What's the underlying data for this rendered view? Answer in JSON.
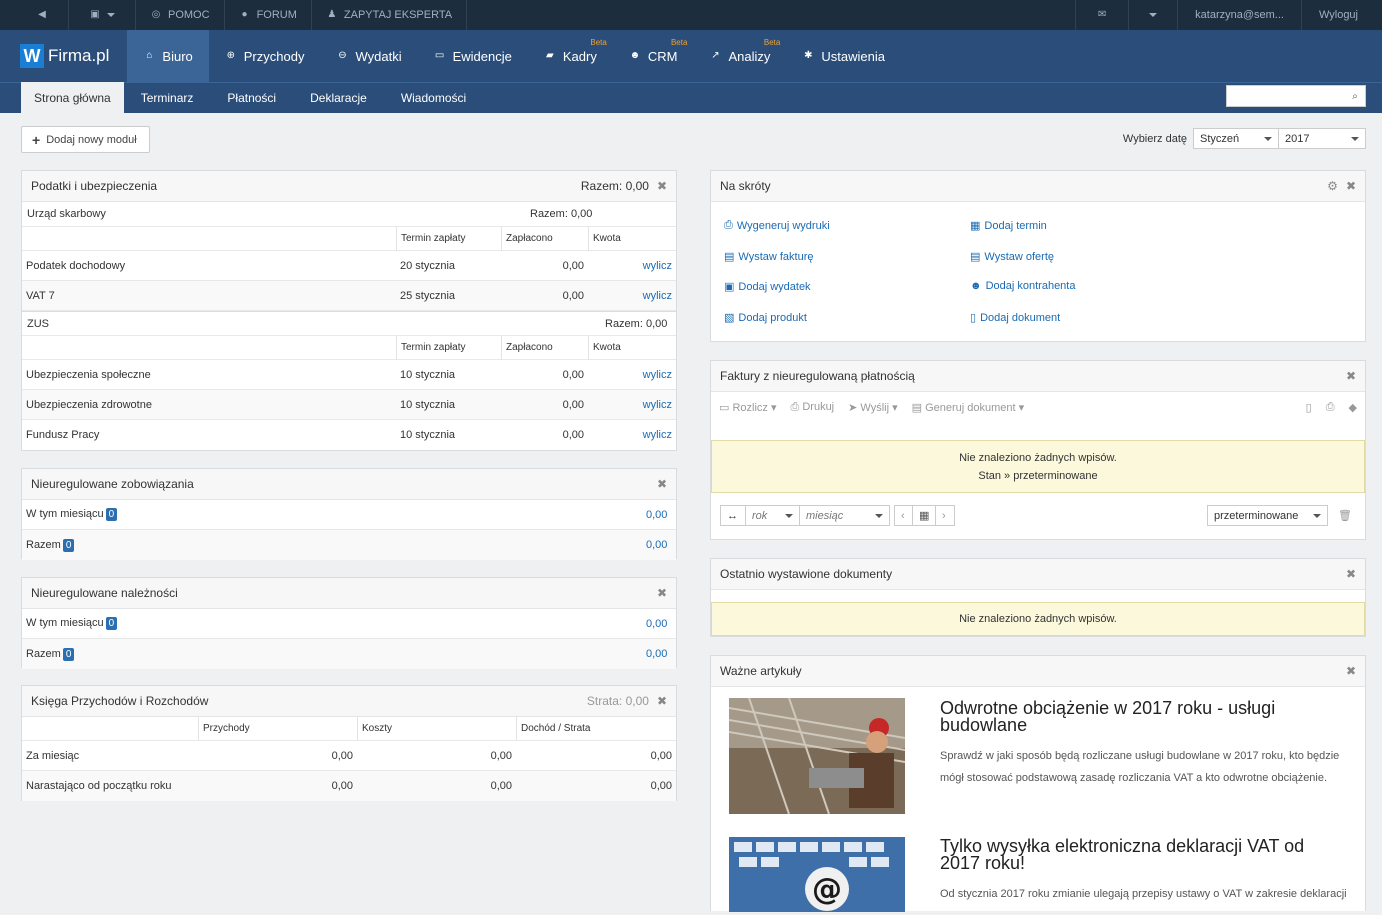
{
  "topbar": {
    "help": "POMOC",
    "forum": "FORUM",
    "expert": "ZAPYTAJ EKSPERTA",
    "user": "katarzyna@sem...",
    "logout": "Wyloguj"
  },
  "brand": {
    "name": "Firma.pl",
    "letter": "W"
  },
  "nav": [
    {
      "label": "Biuro"
    },
    {
      "label": "Przychody"
    },
    {
      "label": "Wydatki"
    },
    {
      "label": "Ewidencje"
    },
    {
      "label": "Kadry",
      "beta": "Beta"
    },
    {
      "label": "CRM",
      "beta": "Beta"
    },
    {
      "label": "Analizy",
      "beta": "Beta"
    },
    {
      "label": "Ustawienia"
    }
  ],
  "subnav": [
    "Strona główna",
    "Terminarz",
    "Płatności",
    "Deklaracje",
    "Wiadomości"
  ],
  "toolbar": {
    "add_module": "Dodaj nowy moduł",
    "date_label": "Wybierz datę",
    "month": "Styczeń",
    "year": "2017"
  },
  "taxes": {
    "title": "Podatki i ubezpieczenia",
    "total": "Razem: 0,00",
    "us": {
      "title": "Urząd skarbowy",
      "total": "Razem: 0,00"
    },
    "cols": [
      "Termin zapłaty",
      "Zapłacono",
      "Kwota"
    ],
    "us_rows": [
      {
        "name": "Podatek dochodowy",
        "date": "20 stycznia",
        "paid": "0,00",
        "action": "wylicz"
      },
      {
        "name": "VAT 7",
        "date": "25 stycznia",
        "paid": "0,00",
        "action": "wylicz"
      }
    ],
    "zus": {
      "title": "ZUS",
      "total": "Razem: 0,00"
    },
    "zus_rows": [
      {
        "name": "Ubezpieczenia społeczne",
        "date": "10 stycznia",
        "paid": "0,00",
        "action": "wylicz"
      },
      {
        "name": "Ubezpieczenia zdrowotne",
        "date": "10 stycznia",
        "paid": "0,00",
        "action": "wylicz"
      },
      {
        "name": "Fundusz Pracy",
        "date": "10 stycznia",
        "paid": "0,00",
        "action": "wylicz"
      }
    ]
  },
  "liabilities": {
    "title": "Nieuregulowane zobowiązania",
    "month_label": "W tym miesiącu",
    "month_count": "0",
    "month_value": "0,00",
    "total_label": "Razem",
    "total_count": "0",
    "total_value": "0,00"
  },
  "receivables": {
    "title": "Nieuregulowane należności",
    "month_label": "W tym miesiącu",
    "month_count": "0",
    "month_value": "0,00",
    "total_label": "Razem",
    "total_count": "0",
    "total_value": "0,00"
  },
  "ledger": {
    "title": "Księga Przychodów i Rozchodów",
    "loss": "Strata: 0,00",
    "cols": [
      "Przychody",
      "Koszty",
      "Dochód / Strata"
    ],
    "rows": [
      {
        "label": "Za miesiąc",
        "v1": "0,00",
        "v2": "0,00",
        "v3": "0,00"
      },
      {
        "label": "Narastająco od początku roku",
        "v1": "0,00",
        "v2": "0,00",
        "v3": "0,00"
      }
    ]
  },
  "shortcuts": {
    "title": "Na skróty",
    "items": [
      "Wygeneruj wydruki",
      "Dodaj termin",
      "Wystaw fakturę",
      "Wystaw ofertę",
      "Dodaj wydatek",
      "Dodaj kontrahenta",
      "Dodaj produkt",
      "Dodaj dokument"
    ]
  },
  "invoices": {
    "title": "Faktury z nieuregulowaną płatnością",
    "actions": [
      "Rozlicz",
      "Drukuj",
      "Wyślij",
      "Generuj dokument"
    ],
    "empty": "Nie znaleziono żadnych wpisów.",
    "state": "Stan » przeterminowane",
    "year_ph": "rok",
    "month_ph": "miesiąc",
    "status": "przeterminowane"
  },
  "recent": {
    "title": "Ostatnio wystawione dokumenty",
    "empty": "Nie znaleziono żadnych wpisów."
  },
  "articles": {
    "title": "Ważne artykuły",
    "items": [
      {
        "title": "Odwrotne obciążenie w 2017 roku - usługi budowlane",
        "text": "Sprawdź w jaki sposób będą rozliczane usługi budowlane w 2017 roku, kto będzie mógł stosować podstawową zasadę rozliczania VAT a kto odwrotne obciążenie."
      },
      {
        "title": "Tylko wysyłka elektroniczna deklaracji VAT od 2017 roku!",
        "text": "Od stycznia 2017 roku zmianie ulegają przepisy ustawy o VAT w zakresie deklaracji"
      }
    ]
  }
}
